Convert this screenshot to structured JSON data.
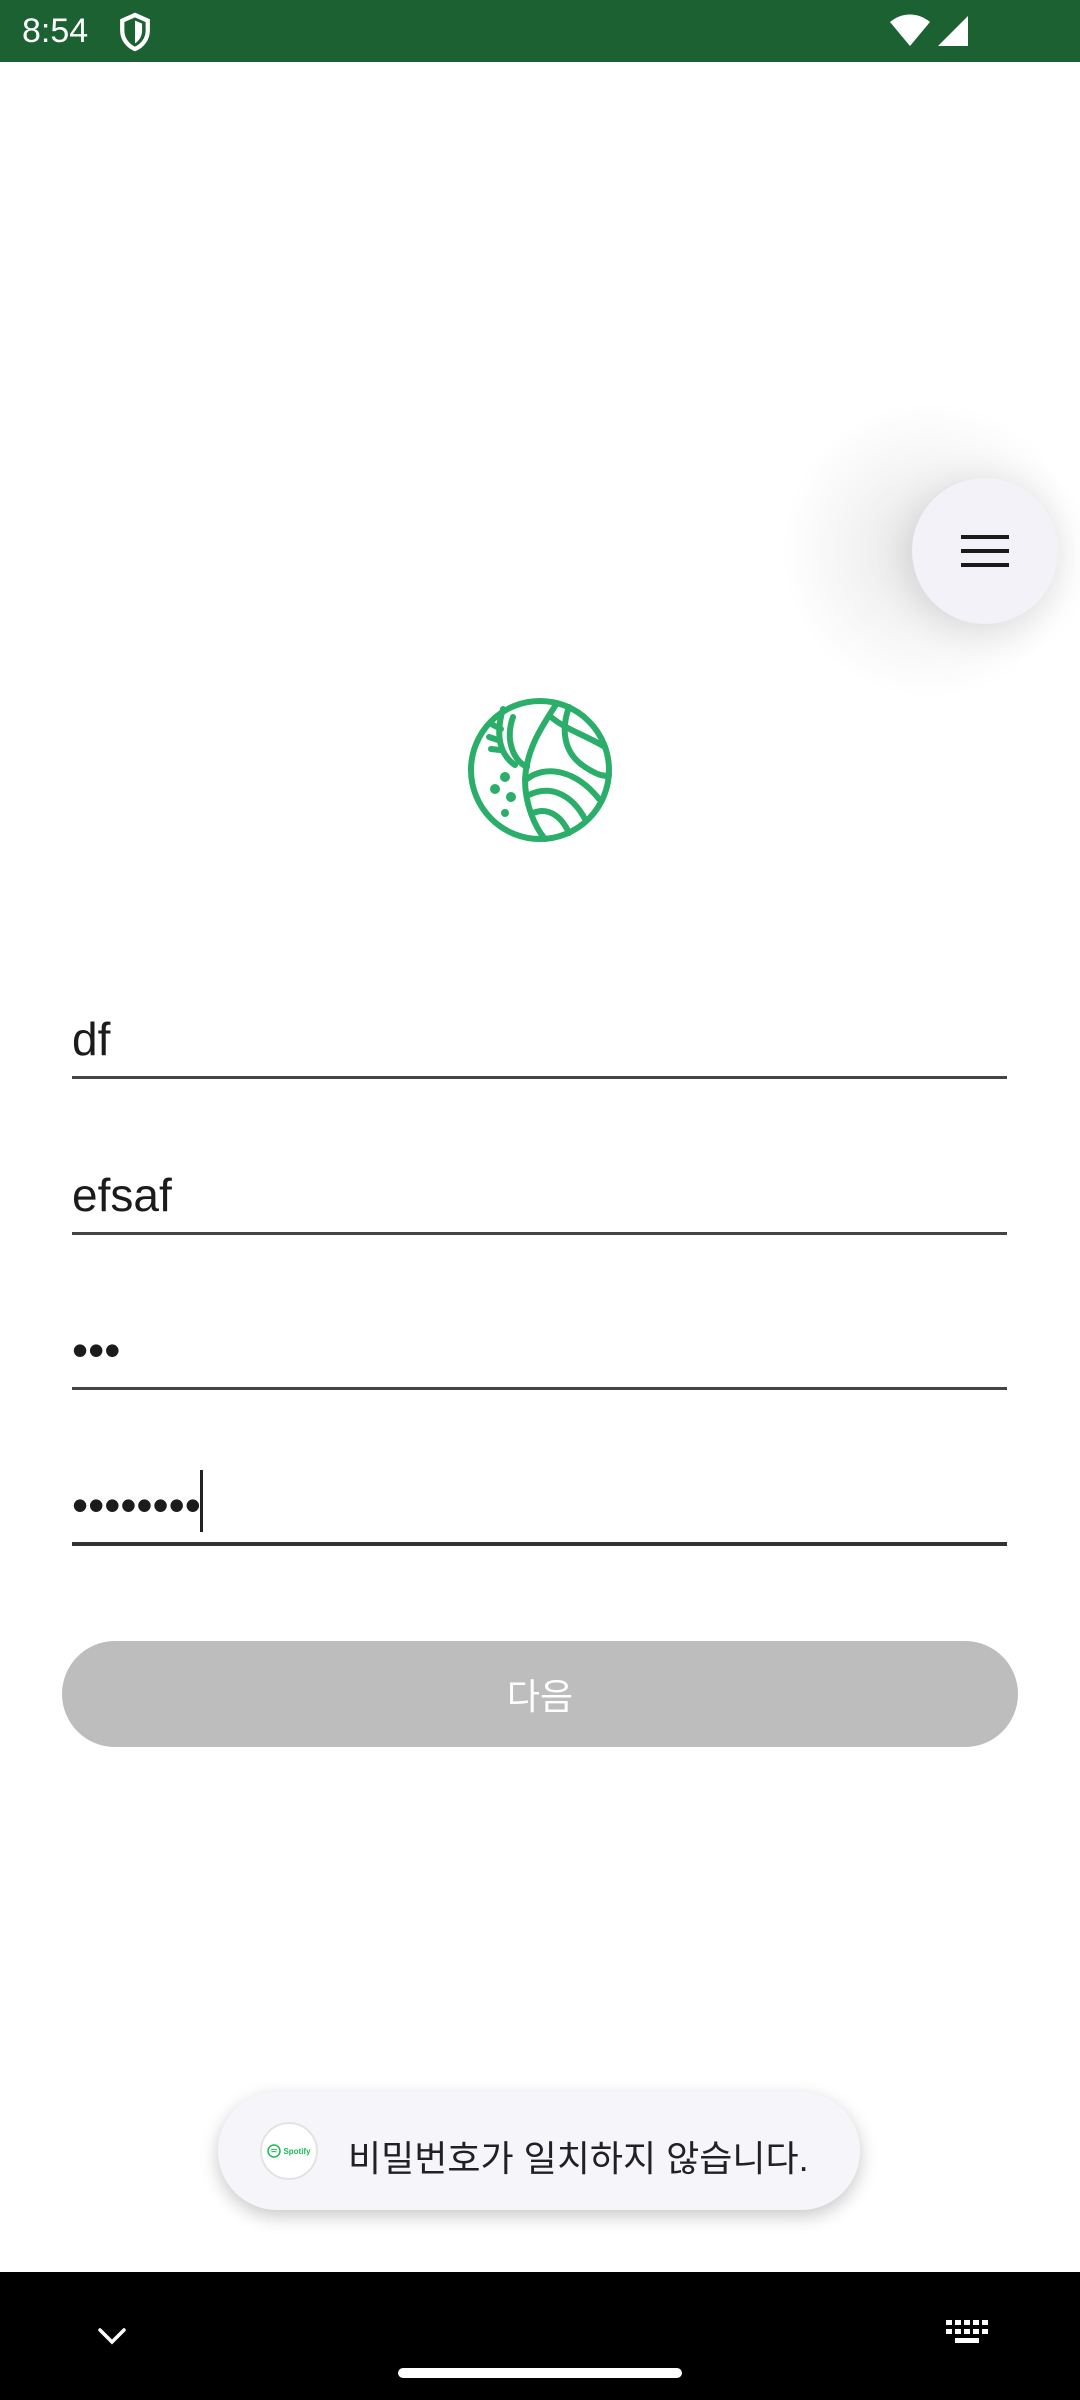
{
  "status_bar": {
    "time": "8:54",
    "icons": [
      "shield-icon",
      "wifi-icon",
      "signal-icon"
    ],
    "background": "#1c6131"
  },
  "menu_button": {
    "icon": "hamburger-menu-icon"
  },
  "logo": {
    "icon": "yarn-ball-logo-icon",
    "color": "#2aae6a"
  },
  "form": {
    "fields": [
      {
        "value": "df"
      },
      {
        "value": "efsaf"
      },
      {
        "value": "•••"
      },
      {
        "value": "••••••••"
      }
    ],
    "next_button_label": "다음",
    "next_button_color": "#bdbdbd"
  },
  "toast": {
    "app_icon": "spotify-icon",
    "app_icon_label": "Spotify",
    "message": "비밀번호가 일치하지 않습니다."
  },
  "nav_bar": {
    "icons": [
      "chevron-down-icon",
      "home-handle",
      "keyboard-icon"
    ]
  }
}
